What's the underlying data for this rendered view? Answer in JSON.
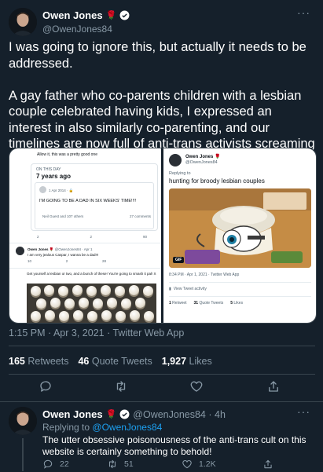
{
  "tweet": {
    "author_name": "Owen Jones",
    "author_emoji": "🌹",
    "author_handle": "@OwenJones84",
    "text_p1": "I was going to ignore this, but actually it needs to be addressed.",
    "text_p2": "A gay father who co-parents children with a lesbian couple celebrated having kids, I expressed an interest in also similarly co-parenting, and our timelines are now full of anti-trans activists screaming at us.",
    "timestamp": "1:15 PM · Apr 3, 2021 · Twitter Web App",
    "retweets_count": "165",
    "retweets_label": "Retweets",
    "quotes_count": "46",
    "quotes_label": "Quote Tweets",
    "likes_count": "1,927",
    "likes_label": "Likes",
    "more_icon": "more-dots-icon"
  },
  "left_shot": {
    "top_text": "Allow it, this was a pretty good one",
    "on_this_day": "ON THIS DAY",
    "years_ago": "7 years ago",
    "inner_date": "1 Apr 2014 · 🔒",
    "inner_text": "I'M GOING TO BE A DAD IN SIX WEEKS' TIME!!!!",
    "inner_meta_left": "Neil Guest and 107 others",
    "inner_meta_right": "27 comments",
    "actions": [
      "2",
      "2",
      "90"
    ],
    "reply_name": "Owen Jones 🌹",
    "reply_handle": "@OwenJones84 · Apr 1",
    "reply_text": "I am very jealous Caspar, I wanna be a dad!!!",
    "reply_actions": [
      "10",
      "2",
      "28"
    ],
    "bottom_text": "Get yourself a lesbian or two, and a bunch of these! You're going to smash it pal! X"
  },
  "right_shot": {
    "name": "Owen Jones 🌹",
    "handle": "@OwenJones84",
    "replying_to": "Replying to",
    "text": "hunting for broody lesbian couples",
    "gif_badge": "GIF",
    "meta": "8:34 PM · Apr 1, 2021 · Twitter Web App",
    "activity": "View Tweet activity",
    "stats": [
      {
        "count": "1",
        "label": "Retweet"
      },
      {
        "count": "31",
        "label": "Quote Tweets"
      },
      {
        "count": "5",
        "label": "Likes"
      }
    ]
  },
  "reply": {
    "author_name": "Owen Jones",
    "author_emoji": "🌹",
    "author_handle": "@OwenJones84 · 4h",
    "replying_prefix": "Replying to",
    "replying_handle": "@OwenJones84",
    "text": "The utter obsessive poisonousness of the anti-trans cult on this website is certainly something to behold!",
    "replies": "22",
    "retweets": "51",
    "likes": "1.2K"
  },
  "colors": {
    "background": "#15202b",
    "accent": "#1da1f2",
    "muted": "#8899a6",
    "divider": "#38444d"
  }
}
